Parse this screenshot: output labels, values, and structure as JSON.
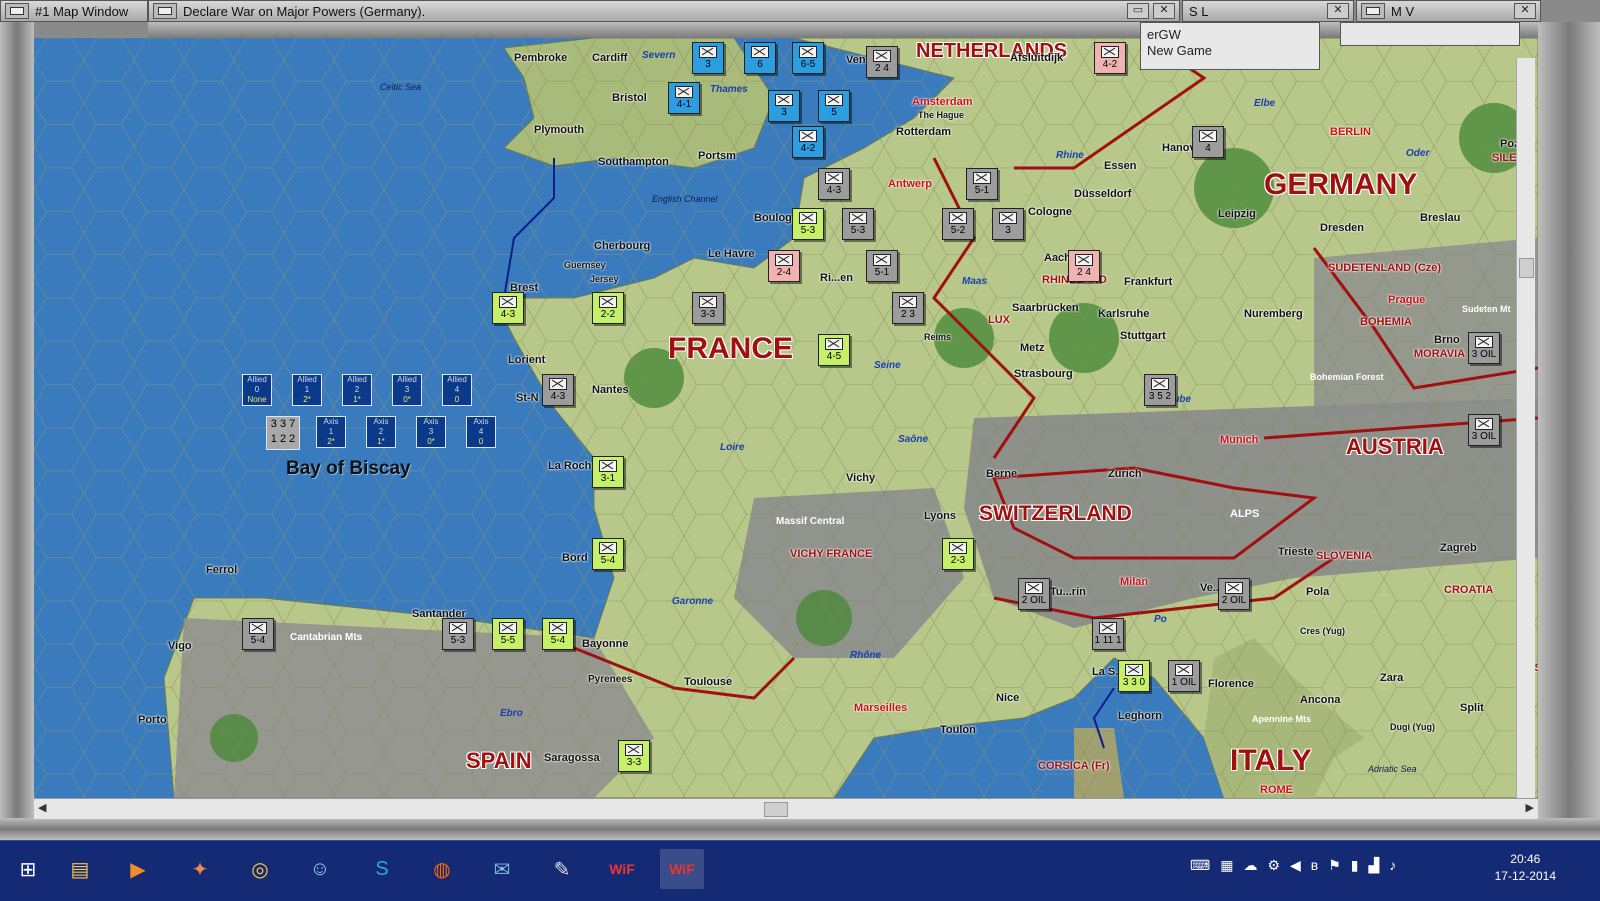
{
  "windows": {
    "map_window": "#1 Map Window",
    "main_title": "Declare War on Major Powers (Germany).",
    "sl_title": "S L",
    "mv_title": "M V",
    "sl_line1": "erGW",
    "sl_line2": "New Game"
  },
  "map": {
    "countries": [
      {
        "name": "NETHERLANDS"
      },
      {
        "name": "GERMANY"
      },
      {
        "name": "FRANCE"
      },
      {
        "name": "SWITZERLAND"
      },
      {
        "name": "AUSTRIA"
      },
      {
        "name": "ITALY"
      },
      {
        "name": "SPAIN"
      }
    ],
    "seas": [
      "Celtic Sea",
      "English Channel",
      "Adriatic Sea"
    ],
    "bay": "Bay of Biscay",
    "cities": [
      "Pembroke",
      "Cardiff",
      "Bristol",
      "Plymouth",
      "Portsm",
      "Southampton",
      "Cherbourg",
      "Le Havre",
      "Guernsey",
      "Jersey",
      "Brest",
      "Boulog",
      "Lorient",
      "St-N",
      "Nantes",
      "La Roch",
      "Bord",
      "Bayonne",
      "Toulouse",
      "Pyrenees",
      "Ferrol",
      "Vigo",
      "Porto",
      "Santander",
      "Saragossa",
      "Vichy",
      "Lyons",
      "Reims",
      "Metz",
      "Strasbourg",
      "Saarbrücken",
      "Karlsruhe",
      "Stuttgart",
      "Nuremberg",
      "Frankfurt",
      "Aachen",
      "Cologne",
      "Düsseldorf",
      "Essen",
      "Hanover",
      "Leipzig",
      "Dresden",
      "Breslau",
      "Afsluitdijk",
      "The Hague",
      "Rotterdam",
      "Berne",
      "Zurich",
      "Trieste",
      "Zagreb",
      "Pola",
      "Cres (Yug)",
      "Zara",
      "Split",
      "Dugi (Yug)",
      "Ancona",
      "Florence",
      "Leghorn",
      "Nice",
      "Toulon",
      "ALPS",
      "Apennine Mts",
      "Cantabrian Mts",
      "Massif Central",
      "Bohemian Forest",
      "Brno",
      "Sudeten Mt",
      "Antwerp",
      "Ri...en",
      "Tu...rin",
      "Ve...",
      "La S...",
      "Pozn",
      "Ven"
    ],
    "capitals": [
      "Amsterdam",
      "BERLIN",
      "Prague",
      "Munich",
      "Milan",
      "Marseilles",
      "ROME"
    ],
    "rivers": [
      "Severn",
      "Thames",
      "Rhine",
      "Elbe",
      "Oder",
      "Maas",
      "Seine",
      "Loire",
      "Saône",
      "Garonne",
      "Rhône",
      "Ebro",
      "Po",
      "Dube"
    ],
    "regions": [
      "SUDETENLAND (Cze)",
      "BOHEMIA",
      "MORAVIA",
      "VICHY FRANCE",
      "SLOVENIA",
      "CROATIA",
      "CORSICA (Fr)",
      "LUX",
      "RHINELAND",
      "BOSN",
      "SILESIA"
    ],
    "allied_boxes": [
      {
        "label": "Allied",
        "n": "0",
        "v": "None"
      },
      {
        "label": "Allied",
        "n": "1",
        "v": "2*"
      },
      {
        "label": "Allied",
        "n": "2",
        "v": "1*"
      },
      {
        "label": "Allied",
        "n": "3",
        "v": "0*"
      },
      {
        "label": "Allied",
        "n": "4",
        "v": "0"
      }
    ],
    "axis_boxes": [
      {
        "label": "Axis",
        "n": "1",
        "v": "2*"
      },
      {
        "label": "Axis",
        "n": "2",
        "v": "1*"
      },
      {
        "label": "Axis",
        "n": "3",
        "v": "0*"
      },
      {
        "label": "Axis",
        "n": "4",
        "v": "0"
      }
    ],
    "axis_summary": {
      "top": "3 3 7",
      "bottom": "1 2 2"
    },
    "counters": [
      {
        "v": "4-3",
        "side": "fr"
      },
      {
        "v": "2-2",
        "side": "fr"
      },
      {
        "v": "3-3",
        "side": "de"
      },
      {
        "v": "4-5",
        "side": "fr"
      },
      {
        "v": "4-3",
        "side": "de"
      },
      {
        "v": "3-1",
        "side": "fr"
      },
      {
        "v": "5-4",
        "side": "fr"
      },
      {
        "v": "5-4",
        "side": "de"
      },
      {
        "v": "5-3",
        "side": "de"
      },
      {
        "v": "5-5",
        "side": "fr"
      },
      {
        "v": "5-4",
        "side": "fr"
      },
      {
        "v": "3-3",
        "side": "fr"
      },
      {
        "v": "2-4",
        "side": "red"
      },
      {
        "v": "5-1",
        "side": "de"
      },
      {
        "v": "5-3",
        "side": "fr"
      },
      {
        "v": "5-3",
        "side": "de"
      },
      {
        "v": "5-2",
        "side": "de"
      },
      {
        "v": "4-3",
        "side": "de"
      },
      {
        "v": "5-1",
        "side": "de"
      },
      {
        "v": "2-3",
        "side": "fr"
      },
      {
        "v": "4-1",
        "side": "uk"
      },
      {
        "v": "4-2",
        "side": "uk"
      },
      {
        "v": "6-5",
        "side": "uk"
      },
      {
        "v": "4-2",
        "side": "red"
      },
      {
        "v": "3",
        "side": "uk"
      },
      {
        "v": "6",
        "side": "uk"
      },
      {
        "v": "3",
        "side": "uk"
      },
      {
        "v": "5",
        "side": "uk"
      },
      {
        "v": "2 4",
        "side": "de"
      },
      {
        "v": "2 3",
        "side": "de"
      },
      {
        "v": "3 5 2",
        "side": "de"
      },
      {
        "v": "2 4",
        "side": "red"
      },
      {
        "v": "4",
        "side": "de"
      },
      {
        "v": "3",
        "side": "de"
      },
      {
        "v": "1 11 1",
        "side": "de"
      },
      {
        "v": "3 3 0",
        "side": "fr"
      },
      {
        "v": "2 OIL",
        "side": "de"
      },
      {
        "v": "2 OIL",
        "side": "de"
      },
      {
        "v": "1 OIL",
        "side": "de"
      },
      {
        "v": "3 OIL",
        "side": "de"
      },
      {
        "v": "3 OIL",
        "side": "de"
      }
    ]
  },
  "taskbar": {
    "time": "20:46",
    "date": "17-12-2014",
    "apps": [
      "windows-logo-icon",
      "file-explorer-icon",
      "media-player-icon",
      "game-icon",
      "chrome-icon",
      "messenger-icon",
      "skype-icon",
      "firefox-icon",
      "thunderbird-icon",
      "editor-icon",
      "woff-icon",
      "woff-icon"
    ]
  },
  "colors": {
    "sea": "#3a7bbd",
    "land": "#b8c88a",
    "forest": "#4a8a3a",
    "mountain": "#8a8a8a",
    "border": "#a01010",
    "taskbar": "#152a74"
  }
}
